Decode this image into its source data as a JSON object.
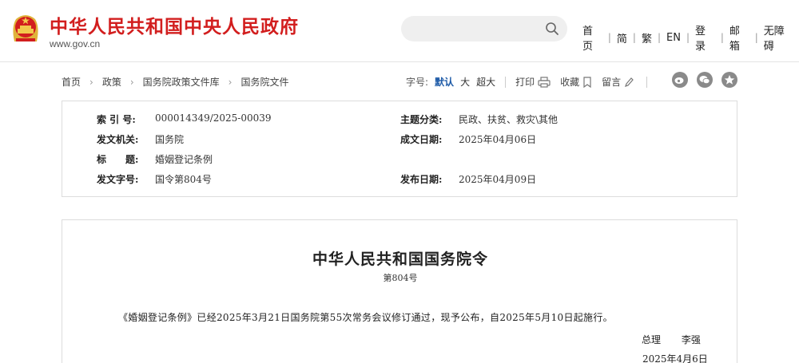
{
  "header": {
    "site_title": "中华人民共和国中央人民政府",
    "site_url": "www.gov.cn",
    "search": {
      "placeholder": ""
    },
    "nav": [
      "首页",
      "简",
      "繁",
      "EN",
      "登录",
      "邮箱",
      "无障碍"
    ],
    "brand_color": "#d21e1e"
  },
  "breadcrumb": [
    "首页",
    "政策",
    "国务院政策文件库",
    "国务院文件"
  ],
  "toolbar": {
    "font_size_label": "字号:",
    "sizes": {
      "default": "默认",
      "large": "大",
      "xlarge": "超大"
    },
    "print_label": "打印",
    "favorite_label": "收藏",
    "comment_label": "留言",
    "share_icons": [
      "weibo-icon",
      "wechat-icon",
      "qzone-icon"
    ]
  },
  "info": {
    "index_label": "索 引 号:",
    "index_value": "000014349/2025-00039",
    "category_label": "主题分类:",
    "category_value": "民政、扶贫、救灾\\其他",
    "issuer_label": "发文机关:",
    "issuer_value": "国务院",
    "written_label": "成文日期:",
    "written_value": "2025年04月06日",
    "title_label": "标　　题:",
    "title_value": "婚姻登记条例",
    "docno_label": "发文字号:",
    "docno_value": "国令第804号",
    "published_label": "发布日期:",
    "published_value": "2025年04月09日"
  },
  "document": {
    "title": "中华人民共和国国务院令",
    "number": "第804号",
    "body": "《婚姻登记条例》已经2025年3月21日国务院第55次常务会议修订通过，现予公布，自2025年5月10日起施行。",
    "signer_role": "总理",
    "signer_name": "李强",
    "sign_date": "2025年4月6日"
  }
}
